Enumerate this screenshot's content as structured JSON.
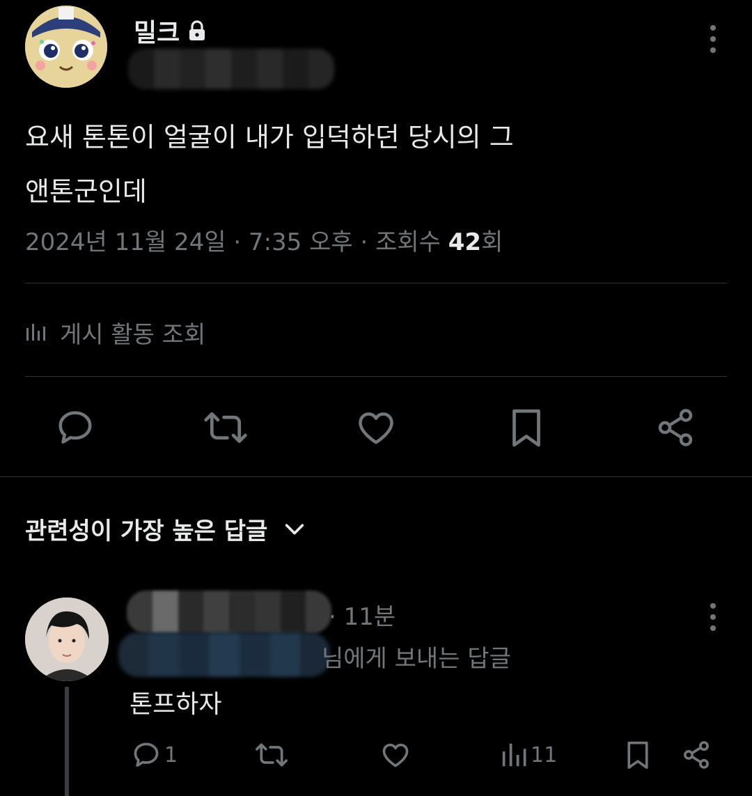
{
  "post": {
    "author": {
      "display_name": "밀크",
      "locked_icon": "lock-icon",
      "avatar_icon": "cartoon-character-avatar"
    },
    "text_line1": "요새 톤톤이 얼굴이 내가 입덕하던 당시의 그",
    "text_line2": "앤톤군인데",
    "meta": {
      "date_time": "2024년 11월 24일 · 7:35 오후 · 조회수 ",
      "views": "42",
      "views_suffix": "회"
    },
    "activity_label": "게시 활동 조회",
    "actions": [
      "reply-icon",
      "repost-icon",
      "like-icon",
      "bookmark-icon",
      "share-icon"
    ]
  },
  "replies_sort": {
    "label": "관련성이 가장 높은 답글"
  },
  "reply": {
    "time": "· 11분",
    "replying_to": "님에게 보내는 답글",
    "text": "톤프하자",
    "counts": {
      "replies": "1",
      "views": "11"
    }
  },
  "colors": {
    "background": "#000000",
    "text_primary": "#e7e9ea",
    "text_secondary": "#71767b",
    "divider": "#2f3336"
  }
}
